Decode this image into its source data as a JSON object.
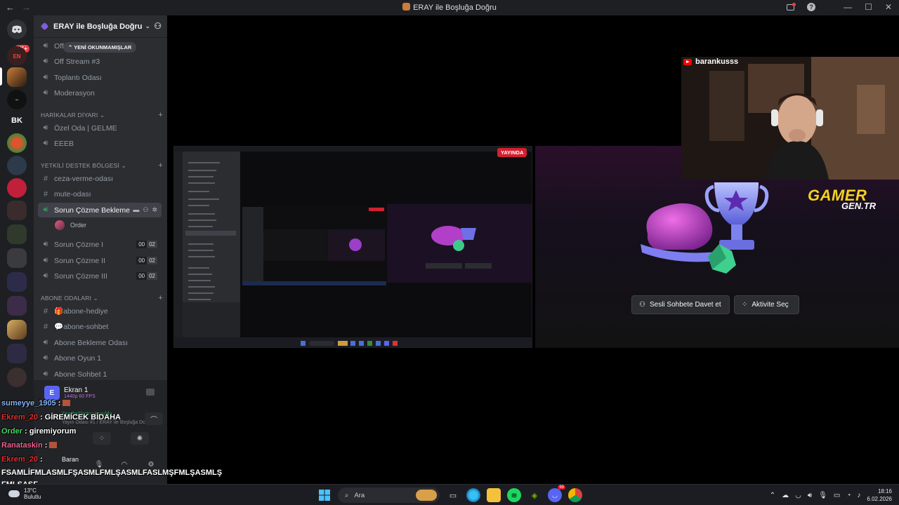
{
  "window": {
    "title": "ERAY ile Boşluğa Doğru"
  },
  "server": {
    "name": "ERAY ile Boşluğa Doğru",
    "rail_badge": "1K+",
    "rail_initials": "BK",
    "unread_pill": "YENİ OKUNMAMIŞLAR"
  },
  "channels_top": [
    {
      "label": "Off"
    },
    {
      "label": "Off Stream #3"
    },
    {
      "label": "Toplantı Odası"
    },
    {
      "label": "Moderasyon"
    }
  ],
  "categories": [
    {
      "label": "HARİKALAR DİYARI"
    },
    {
      "label": "YETKİLİ DESTEK BÖLGESİ"
    },
    {
      "label": "ABONE ODALARI"
    }
  ],
  "channels_harikalar": [
    {
      "label": "Özel Oda | GELME"
    },
    {
      "label": "EEEB"
    }
  ],
  "channels_destek": [
    {
      "label": "ceza-verme-odası"
    },
    {
      "label": "mute-odası"
    },
    {
      "label": "Sorun Çözme Bekleme"
    },
    {
      "label": "Sorun Çözme I",
      "count_a": "00",
      "count_b": "02"
    },
    {
      "label": "Sorun Çözme II",
      "count_a": "00",
      "count_b": "02"
    },
    {
      "label": "Sorun Çözme III",
      "count_a": "00",
      "count_b": "02"
    }
  ],
  "voice_member": "Order",
  "channels_abone": [
    {
      "label": "🎁abone-hediye"
    },
    {
      "label": "💬abone-sohbet"
    },
    {
      "label": "Abone Bekleme Odası"
    },
    {
      "label": "Abone Oyun 1"
    },
    {
      "label": "Abone Sohbet 1"
    }
  ],
  "voice_panel": {
    "stream_title": "Ekran 1",
    "stream_quality": "1440p 60 FPS",
    "status": "Ses Bağlantısı Kuruldu",
    "channel_path": "Yayın Odası #1 / ERAY ile Boşluğa Do...",
    "user_name": "Baran"
  },
  "stream": {
    "live_badge": "YAYINDA",
    "streamer": "barankusss",
    "overlay_brand": "GAMER",
    "overlay_brand_sub": "GEN.TR"
  },
  "activity": {
    "invite_button": "Sesli Sohbete Davet et",
    "activity_button": "Aktivite Seç"
  },
  "chat": [
    {
      "user": "sumeyye_1905",
      "sep": " :",
      "msg": ""
    },
    {
      "user": "Ekrem_20",
      "sep": " :",
      "msg": " GİREMİCEK BİDAHA"
    },
    {
      "user": "Order",
      "sep": " :",
      "msg": " giremiyorum"
    },
    {
      "user": "Ranataskin",
      "sep": " :",
      "msg": ""
    },
    {
      "user": "Ekrem_20",
      "sep": " :",
      "msg": ""
    }
  ],
  "chat_big_message": "FSAMLİFMLASMLFŞASMLFMLŞASMLFASLMŞFMLŞASMLŞ FMLŞASF",
  "taskbar": {
    "weather_temp": "13°C",
    "weather_desc": "Bulutlu",
    "search_placeholder": "Ara",
    "discord_badge": "99",
    "time": "18:16",
    "date": "6.02.2026"
  },
  "colors": {
    "accent": "#5865f2",
    "live": "#d32030",
    "brand_yellow": "#f4d21f"
  }
}
